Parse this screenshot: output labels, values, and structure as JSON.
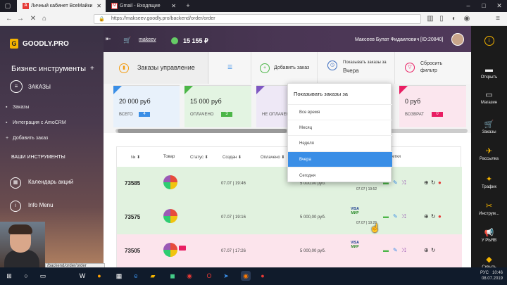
{
  "browser": {
    "tabs": [
      {
        "label": "Личный кабинет ВсеМайки",
        "active": true
      },
      {
        "label": "Gmail - Входящие",
        "active": false
      }
    ],
    "url": "https://makseev.goodly.pro/backend/order/order",
    "status_url": "/backend/order/order"
  },
  "sidebar": {
    "logo_letter": "G",
    "logo": "GOODLY.PRO",
    "title": "Бизнес инструменты",
    "plus": "+",
    "section1": "ЗАКАЗЫ",
    "items": [
      "Заказы",
      "Интеграция с AmoCRM",
      "Добавить заказ"
    ],
    "section2": "ВАШИ ИНСТРУМЕНТЫ",
    "tools": [
      "Календарь акций",
      "Info Menu"
    ]
  },
  "header": {
    "user": "makeev",
    "balance": "15 155 ₽",
    "name": "Максеев Булат Фидаилович [ID:20840]"
  },
  "toolbar": {
    "title": "Заказы управление",
    "add": "Добавить заказ",
    "show_label": "Показывать заказы за",
    "show_value": "Вчера",
    "reset1": "Сбросить",
    "reset2": "фильтр"
  },
  "cards": [
    {
      "amount": "20 000 руб",
      "status": "ВСЕГО",
      "count": "4",
      "color": "#3a8ee6",
      "bg": "#e8f1fb"
    },
    {
      "amount": "15 000 руб",
      "status": "ОПЛАЧЕНО",
      "count": "3",
      "color": "#4cb648",
      "bg": "#e3f4e2"
    },
    {
      "amount": "",
      "status": "НЕ ОПЛАЧЕНО",
      "count": "",
      "color": "#7e57c2",
      "bg": "#eee8f6"
    },
    {
      "amount": "0 руб",
      "status": "ВОЗВРАТ",
      "count": "0",
      "color": "#e91e63",
      "bg": "#fbe6ee"
    }
  ],
  "table": {
    "headers": [
      "№",
      "Товар",
      "Статус",
      "Создан",
      "Оплачено",
      "Метки"
    ],
    "rows": [
      {
        "num": "73585",
        "date": "07.07 | 19:46",
        "sum": "5 000,00 руб.",
        "pdate": "07.07 | 19:52",
        "bg": "#e1f2df"
      },
      {
        "num": "73575",
        "date": "07.07 | 19:16",
        "sum": "5 000,00 руб.",
        "pdate": "07.07 | 19:26",
        "bg": "#e1f2df"
      },
      {
        "num": "73505",
        "date": "07.07 | 17:26",
        "sum": "5 000,00 руб.",
        "pdate": "",
        "bg": "#fce4ec"
      }
    ],
    "pay_label1": "VISA",
    "pay_label2": "МИР"
  },
  "dropdown": {
    "title": "Показывать заказы за",
    "options": [
      "Все время",
      "Месяц",
      "Неделя",
      "Вчера",
      "Сегодня"
    ],
    "selected": 3
  },
  "rightbar": [
    "Открыть",
    "Магазин",
    "Заказы",
    "Рассылка",
    "Трафик",
    "Инструм...",
    "У РЬЯВ",
    "Сквыть"
  ],
  "taskbar": {
    "lang": "РУС",
    "time": "10:46",
    "date": "08.07.2019"
  }
}
